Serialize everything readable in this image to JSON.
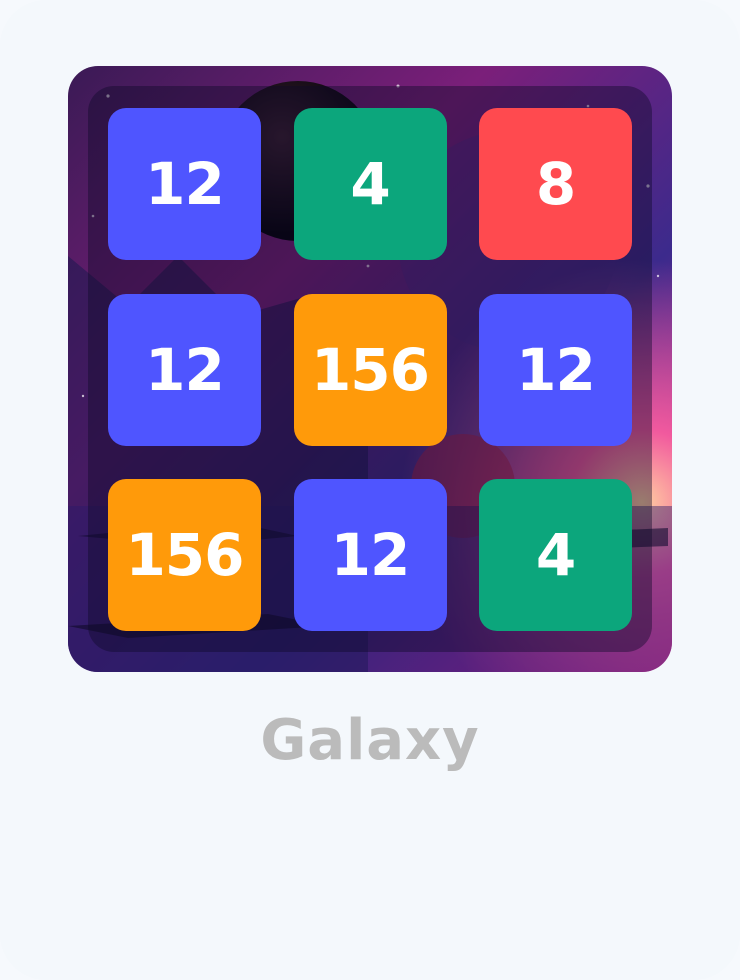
{
  "theme": {
    "name": "Galaxy"
  },
  "colors": {
    "blue": "#4f55ff",
    "green": "#0ca67c",
    "red": "#ff4a4f",
    "orange": "#ff9a0a"
  },
  "board": {
    "rows": 3,
    "cols": 3,
    "tiles": [
      {
        "value": "12",
        "color": "blue"
      },
      {
        "value": "4",
        "color": "green"
      },
      {
        "value": "8",
        "color": "red"
      },
      {
        "value": "12",
        "color": "blue"
      },
      {
        "value": "156",
        "color": "orange"
      },
      {
        "value": "12",
        "color": "blue"
      },
      {
        "value": "156",
        "color": "orange"
      },
      {
        "value": "12",
        "color": "blue"
      },
      {
        "value": "4",
        "color": "green"
      }
    ]
  }
}
